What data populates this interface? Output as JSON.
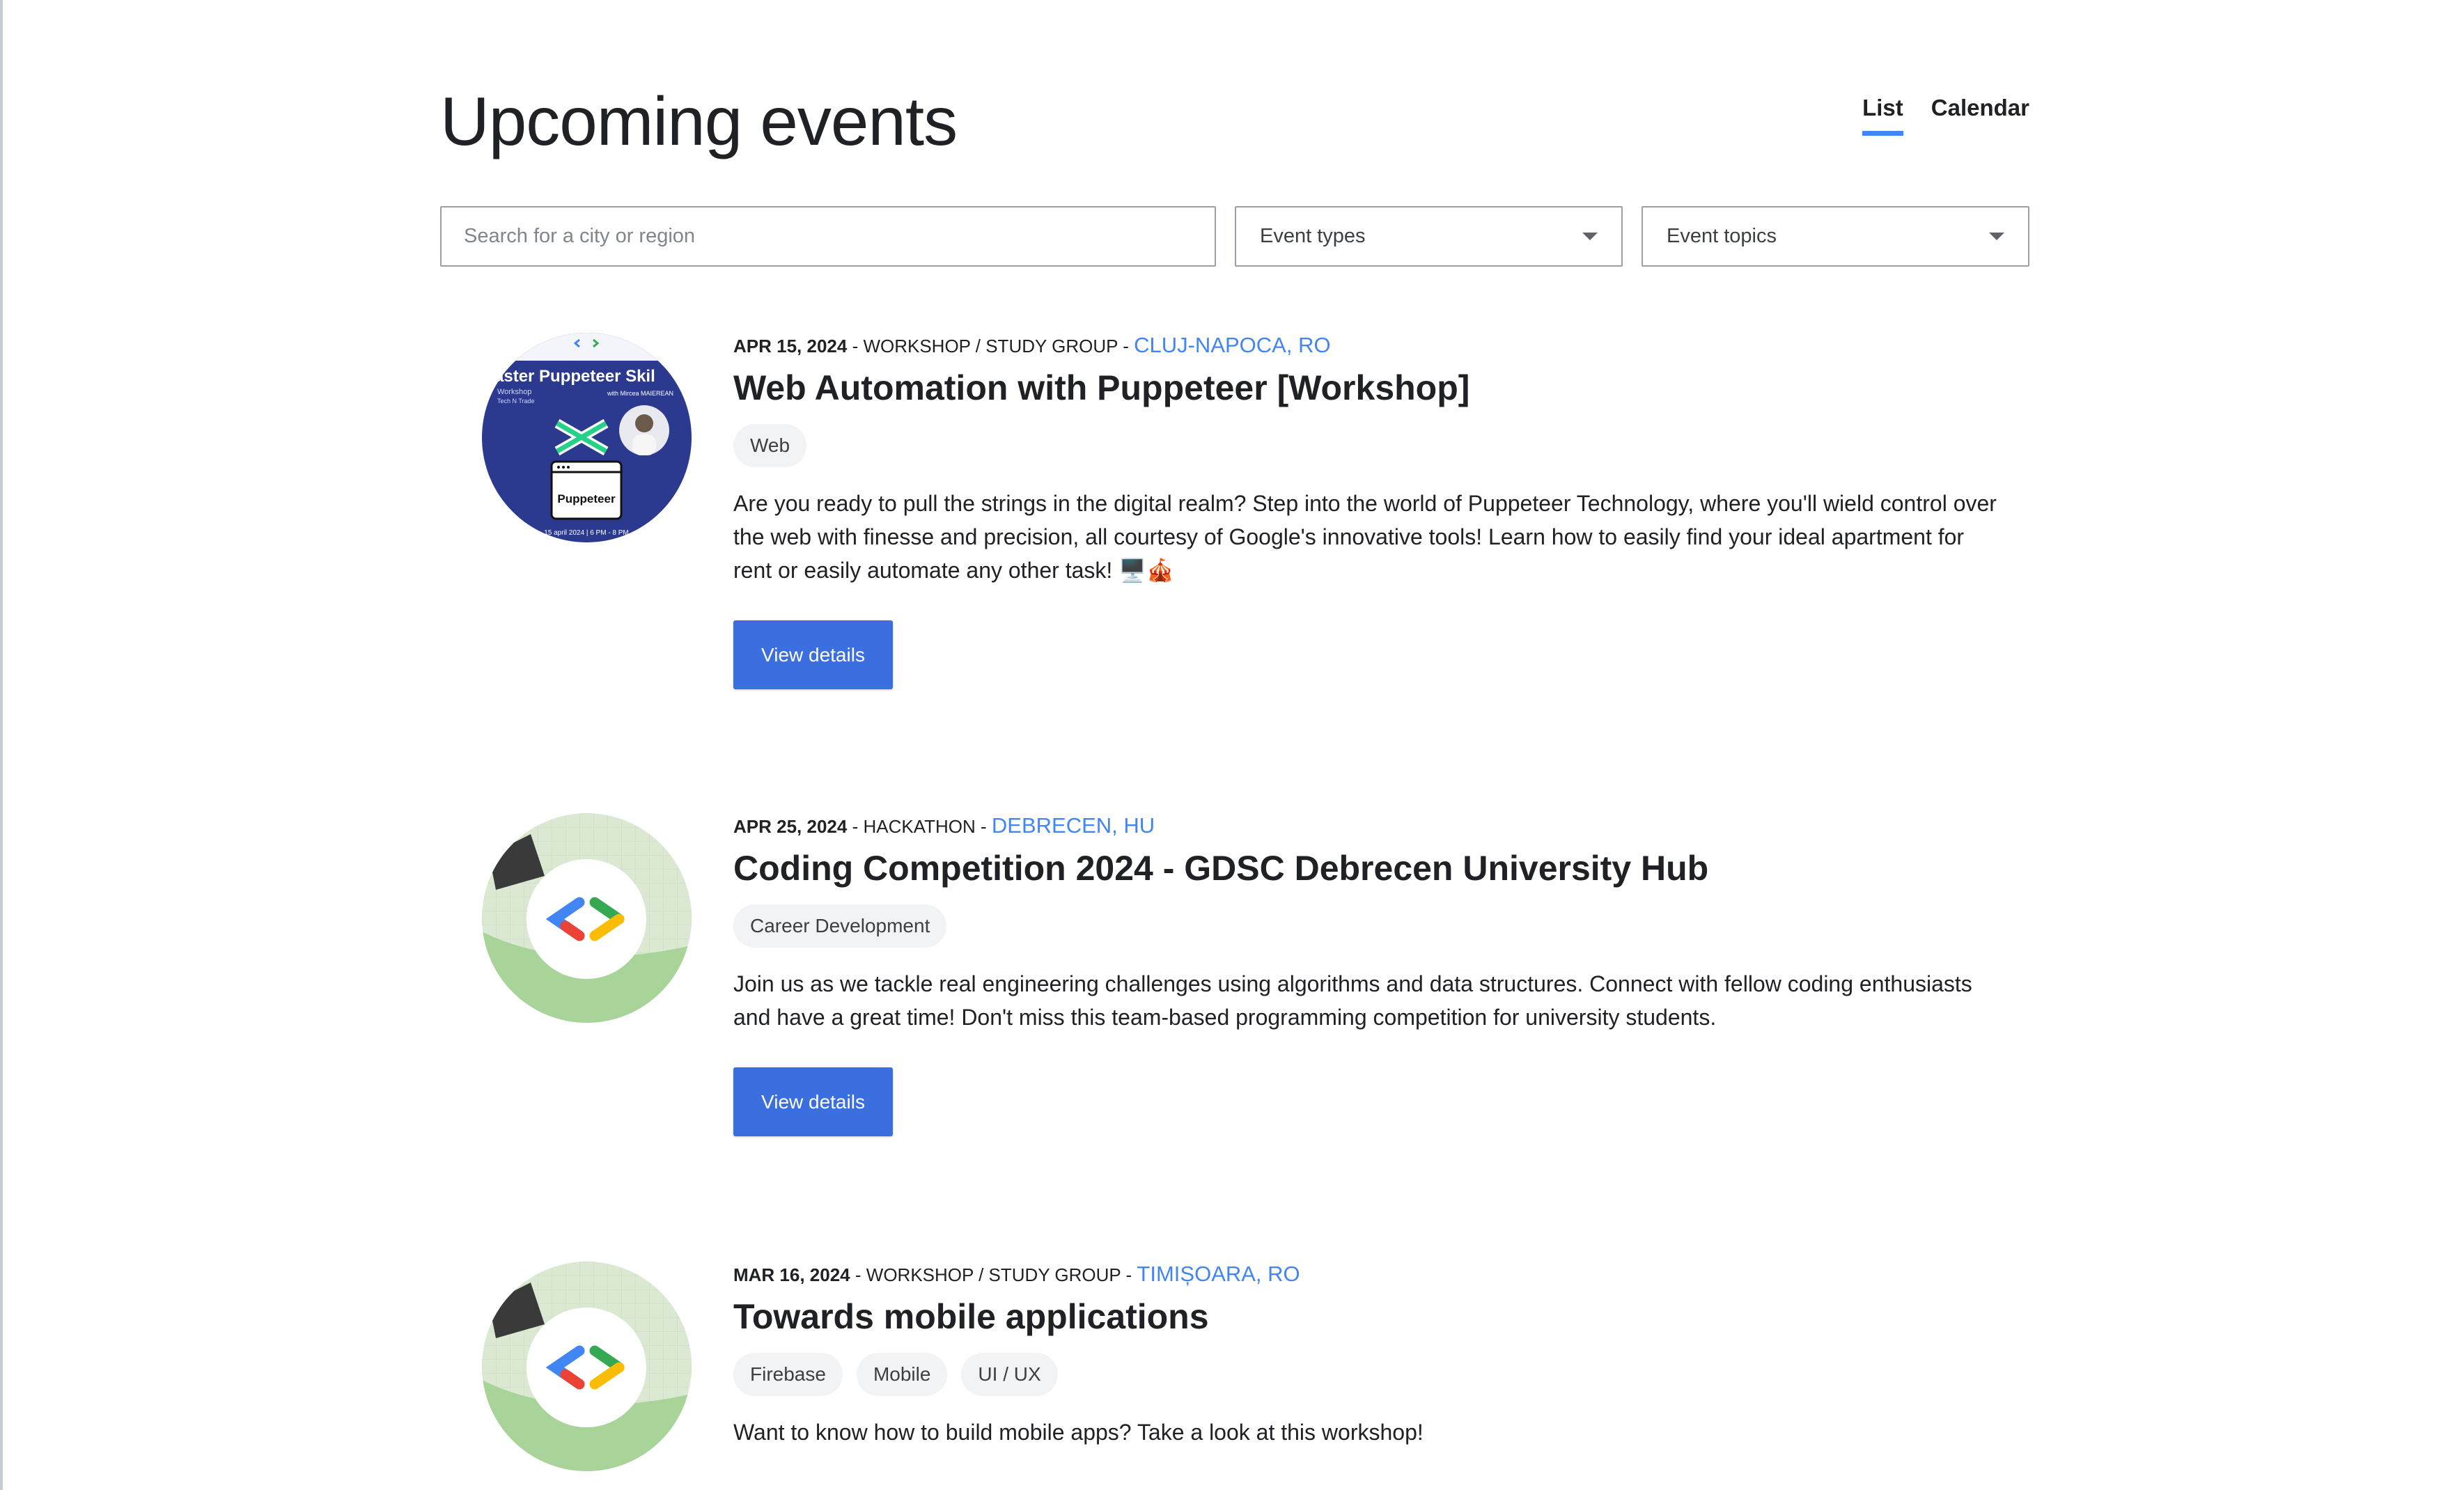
{
  "header": {
    "title": "Upcoming events",
    "tabs": [
      {
        "label": "List",
        "active": true
      },
      {
        "label": "Calendar",
        "active": false
      }
    ]
  },
  "filters": {
    "search_placeholder": "Search for a city or region",
    "event_types_label": "Event types",
    "event_topics_label": "Event topics"
  },
  "colors": {
    "accent": "#4285f4",
    "button": "#3b6fe0",
    "tag_bg": "#f1f3f4"
  },
  "events": [
    {
      "date": "APR 15, 2024",
      "type": "WORKSHOP / STUDY GROUP",
      "location": "CLUJ-NAPOCA, RO",
      "title": "Web Automation with Puppeteer [Workshop]",
      "tags": [
        "Web"
      ],
      "description": "Are you ready to pull the strings in the digital realm? Step into the world of Puppeteer Technology, where you'll wield control over the web with finesse and precision, all courtesy of Google's innovative tools! Learn how to easily find your ideal apartment for rent or easily automate any other task! 🖥️🎪",
      "button_label": "View details",
      "thumbnail": {
        "kind": "poster",
        "headline": "aster Puppeteer Skil",
        "subtitle": "Workshop",
        "speaker": "with Mircea MAIEREAN",
        "brand": "Tech N Trade",
        "logo_text": "Puppeteer",
        "footer": "15 april 2024 | 6 PM - 8 PM"
      }
    },
    {
      "date": "APR 25, 2024",
      "type": "HACKATHON",
      "location": "DEBRECEN, HU",
      "title": "Coding Competition 2024 - GDSC Debrecen University Hub",
      "tags": [
        "Career Development"
      ],
      "description": "Join us as we tackle real engineering challenges using algorithms and data structures. Connect with fellow coding enthusiasts and have a great time! Don't miss this team-based programming competition for university students.",
      "button_label": "View details",
      "thumbnail": {
        "kind": "gdsc-logo"
      }
    },
    {
      "date": "MAR 16, 2024",
      "type": "WORKSHOP / STUDY GROUP",
      "location": "TIMIȘOARA, RO",
      "title": "Towards mobile applications",
      "tags": [
        "Firebase",
        "Mobile",
        "UI / UX"
      ],
      "description": "Want to know how to build mobile apps? Take a look at this workshop!",
      "button_label": "View details",
      "thumbnail": {
        "kind": "gdsc-logo"
      }
    }
  ]
}
